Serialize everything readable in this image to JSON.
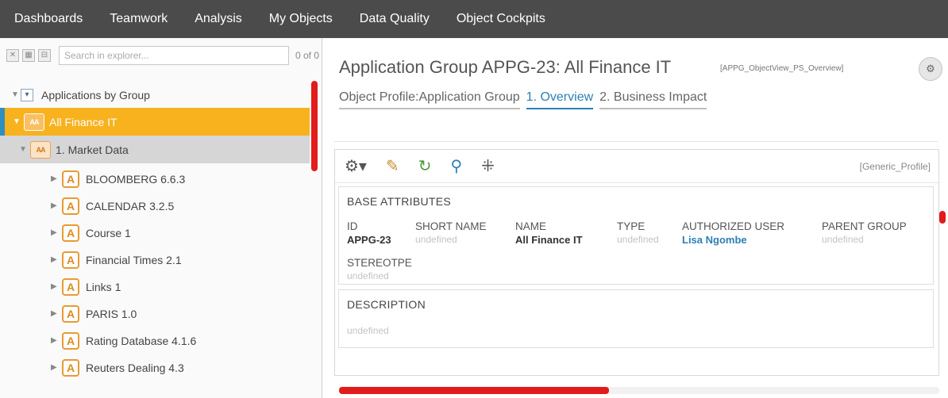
{
  "nav": [
    "Dashboards",
    "Teamwork",
    "Analysis",
    "My Objects",
    "Data Quality",
    "Object Cockpits"
  ],
  "explorer": {
    "search_placeholder": "Search in explorer...",
    "count": "0 of 0",
    "root": "Applications by Group",
    "selected": "All Finance IT",
    "group": "1. Market Data",
    "apps": [
      "BLOOMBERG 6.6.3",
      "CALENDAR 3.2.5",
      "Course 1",
      "Financial Times 2.1",
      "Links 1",
      "PARIS 1.0",
      "Rating Database 4.1.6",
      "Reuters Dealing 4.3"
    ]
  },
  "content": {
    "title": "Application Group APPG-23: All Finance IT",
    "view_id": "[APPG_ObjectView_PS_Overview]",
    "tabs": [
      "Object Profile:Application Group",
      "1. Overview",
      "2. Business Impact"
    ],
    "profile": "[Generic_Profile]",
    "base_title": "BASE ATTRIBUTES",
    "attributes": [
      {
        "label": "ID",
        "value": "APPG-23"
      },
      {
        "label": "SHORT NAME",
        "value": "undefined"
      },
      {
        "label": "NAME",
        "value": "All Finance IT"
      },
      {
        "label": "TYPE",
        "value": "undefined"
      },
      {
        "label": "AUTHORIZED USER",
        "value": "Lisa Ngombe"
      },
      {
        "label": "PARENT GROUP",
        "value": "undefined"
      },
      {
        "label": "STEREOTPE",
        "value": "undefined"
      }
    ],
    "description_title": "DESCRIPTION",
    "description_value": "undefined"
  },
  "colors": {
    "nav_bg": "#4b4b4b",
    "selected_bg": "#f7b21e",
    "accent": "#2c7fb5",
    "scroll": "#e21b1b"
  }
}
